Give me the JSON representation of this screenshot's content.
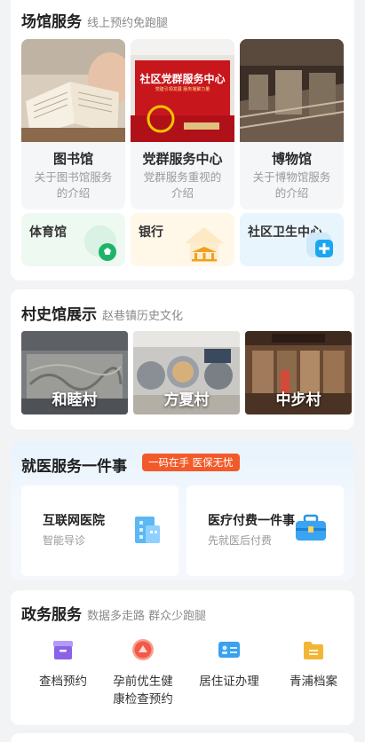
{
  "venues_section": {
    "title": "场馆服务",
    "subtitle": "线上预约免跑腿",
    "venues": [
      {
        "name": "图书馆",
        "desc": "关于图书馆服务的介绍"
      },
      {
        "name": "党群服务中心",
        "desc": "党群服务重视的介绍",
        "photo_sign": "社区党群服务中心",
        "photo_sub": "党建引领发展 服务凝聚力量"
      },
      {
        "name": "博物馆",
        "desc": "关于博物馆服务的介绍"
      }
    ],
    "facilities": [
      {
        "label": "体育馆",
        "icon": "football-icon",
        "color": "#1fb36a"
      },
      {
        "label": "银行",
        "icon": "bank-icon",
        "color": "#f0a020"
      },
      {
        "label": "社区卫生中心",
        "icon": "medical-plus-icon",
        "color": "#1aa6f0"
      }
    ]
  },
  "village_section": {
    "title": "村史馆展示",
    "subtitle": "赵巷镇历史文化",
    "villages": [
      {
        "name": "和睦村"
      },
      {
        "name": "方夏村"
      },
      {
        "name": "中步村"
      }
    ]
  },
  "medical_section": {
    "title": "就医服务一件事",
    "badge": "一码在手 医保无忧",
    "badge_color": "#f25a2a",
    "items": [
      {
        "title": "互联网医院",
        "subtitle": "智能导诊",
        "icon": "hospital-building-icon"
      },
      {
        "title": "医疗付费一件事",
        "subtitle": "先就医后付费",
        "icon": "medical-kit-icon"
      }
    ]
  },
  "gov_section": {
    "title": "政务服务",
    "subtitle": "数据多走路 群众少跑腿",
    "items": [
      {
        "label": "查档预约",
        "icon": "archive-box-icon",
        "color": "#8a63e6"
      },
      {
        "label": "孕前优生健康检查预约",
        "label_line1": "孕前优生健",
        "label_line2": "康检查预约",
        "icon": "health-check-icon",
        "color": "#f05a4a"
      },
      {
        "label": "居住证办理",
        "icon": "id-card-icon",
        "color": "#3aa0f0"
      },
      {
        "label": "青浦档案",
        "icon": "folder-icon",
        "color": "#f2b637"
      }
    ]
  }
}
